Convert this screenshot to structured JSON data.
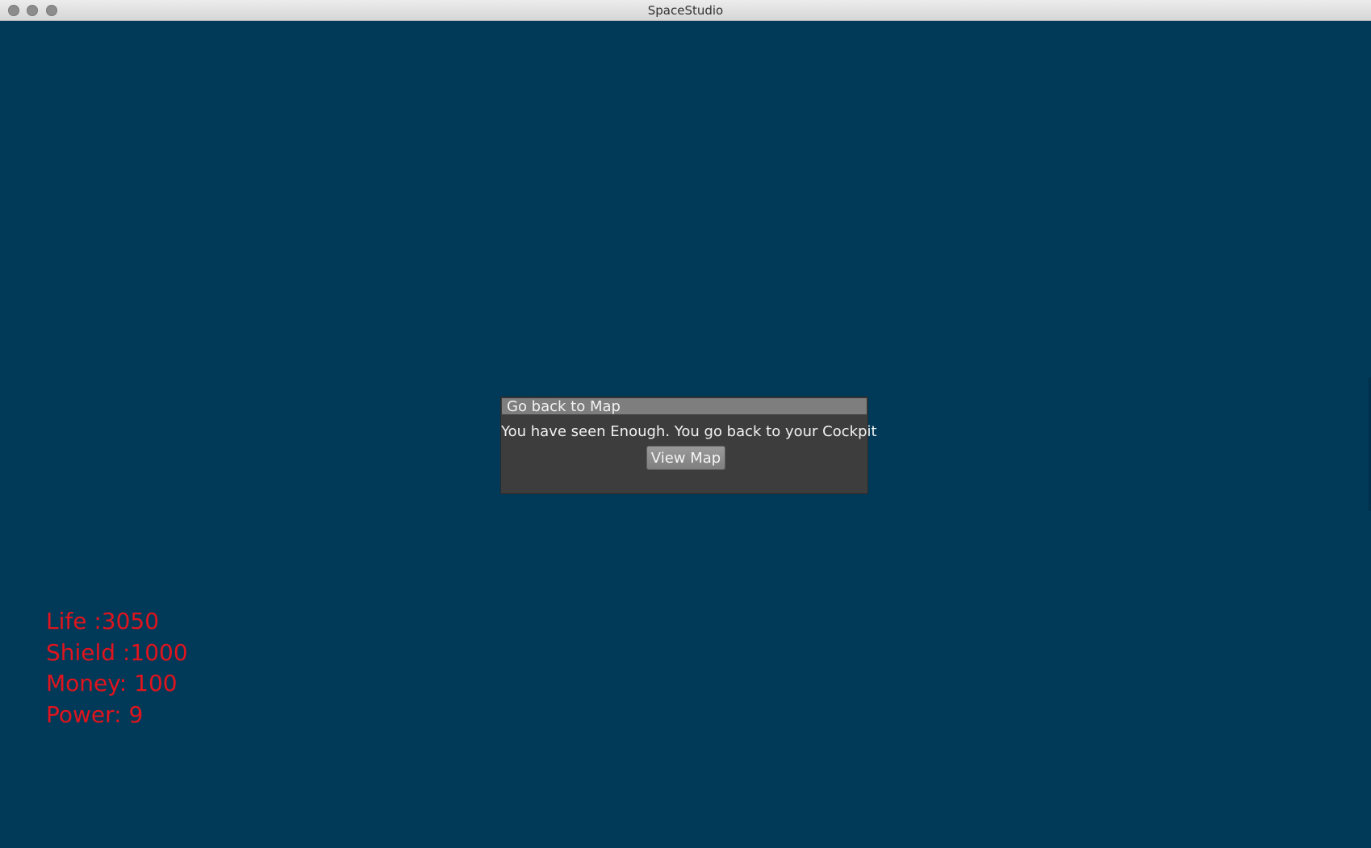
{
  "window": {
    "title": "SpaceStudio"
  },
  "dialog": {
    "title": "Go back to Map",
    "message": "You have seen Enough. You go back to your Cockpit",
    "button_label": "View Map"
  },
  "hud": {
    "life": "Life :3050",
    "shield": "Shield :1000",
    "money": "Money: 100",
    "power": "Power: 9"
  },
  "colors": {
    "background": "#003a58",
    "hud_text": "#e0141e",
    "dialog_body": "#3d3d3d",
    "dialog_title_bar": "#7e7e7e"
  }
}
